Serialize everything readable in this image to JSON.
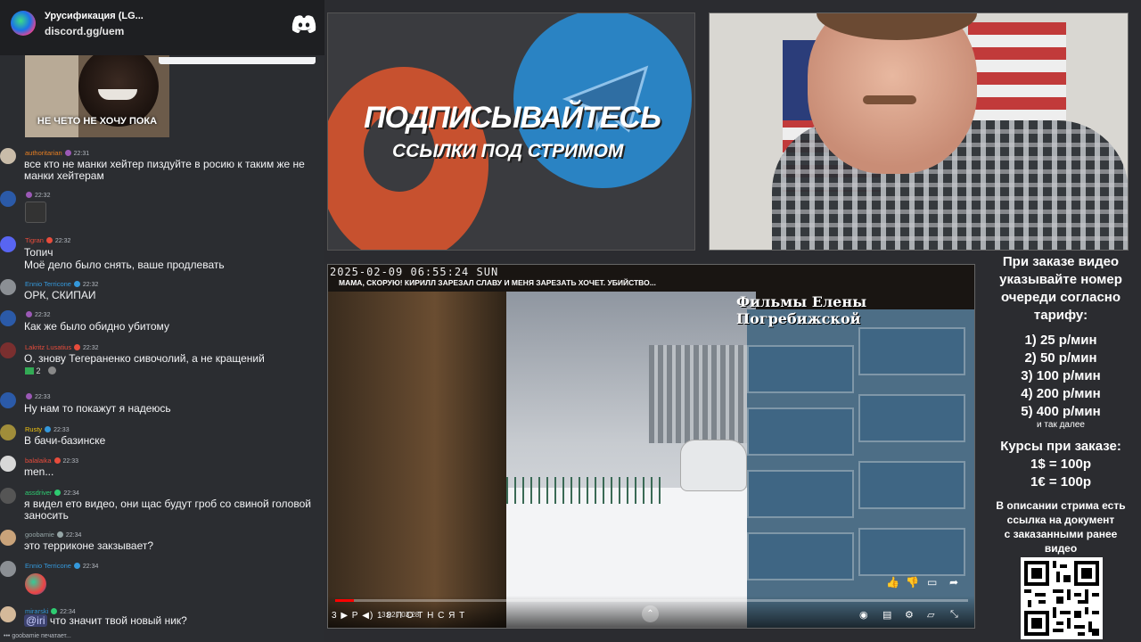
{
  "discord": {
    "server_name": "Урусификация (LG...",
    "invite": "discord.gg/uem"
  },
  "sticker_caption": "НЕ ЧЕТО НЕ ХОЧУ ПОКА",
  "messages": [
    {
      "user": "authoritarian",
      "time": "22:31",
      "text": "все кто не манки хейтер пиздуйте в росию к таким же не манки хейтерам",
      "user_color": "#e67e22"
    },
    {
      "user": "",
      "time": "22:32",
      "text": "",
      "user_color": "#9b59b6"
    },
    {
      "user": "Tigran",
      "time": "22:32",
      "text": "Топич\nМоё дело было снять, ваше продлевать",
      "user_color": "#e74c3c"
    },
    {
      "user": "Ennio Terricone",
      "time": "22:32",
      "text": "ОРК, СКИПАИ",
      "user_color": "#3498db"
    },
    {
      "user": "",
      "time": "22:32",
      "text": "Как же было обидно убитому",
      "user_color": "#9b59b6"
    },
    {
      "user": "Lakritz Lusatius",
      "time": "22:32",
      "text": "О, знову Тегераненко сивочолий, а не кращений",
      "user_color": "#e74c3c"
    },
    {
      "user": "",
      "time": "22:33",
      "text": "Ну нам то покажут я надеюсь",
      "user_color": "#9b59b6"
    },
    {
      "user": "Rusty",
      "time": "22:33",
      "text": "В бачи-базинске",
      "user_color": "#f1c40f"
    },
    {
      "user": "balalaika",
      "time": "22:33",
      "text": "men...",
      "user_color": "#e74c3c"
    },
    {
      "user": "assdriver",
      "time": "22:34",
      "text": "я видел ето видео, они щас будут гроб со свиной головой заносить",
      "user_color": "#2ecc71"
    },
    {
      "user": "goobamie",
      "time": "22:34",
      "text": "это терриконе закзывает?",
      "user_color": "#95a5a6"
    },
    {
      "user": "Ennio Terricone",
      "time": "22:34",
      "text": "",
      "user_color": "#3498db"
    },
    {
      "user": "mirarski",
      "time": "22:34",
      "text": "что значит твой новый ник?",
      "mention": "@iri",
      "user_color": "#3498db"
    }
  ],
  "reaction_count": "2",
  "typing": "goobamie печатает...",
  "promo": {
    "headline": "ПОДПИСЫВАЙТЕСЬ",
    "subline": "ССЫЛКИ ПОД СТРИМОМ"
  },
  "video": {
    "timestamp": "2025-02-09  06:55:24 SUN",
    "title": "МАМА, СКОРУЮ! КИРИЛЛ ЗАРЕЗАЛ СЛАВУ И МЕНЯ ЗАРЕЗАТЬ ХОЧЕТ. УБИЙСТВО...",
    "watermark": "Фильмы Елены Погребижской",
    "time": "3:02 / 03:28",
    "overlay_text": "3 ▶ Р ◀) 1  8  П  О  Т  Н  С  Я  Т",
    "progress": 0.03
  },
  "info": {
    "order_lines": [
      "При заказе видео",
      "указывайте номер",
      "очереди согласно",
      "тарифу:"
    ],
    "tariffs": [
      "1) 25 р/мин",
      "2) 50 р/мин",
      "3) 100 р/мин",
      "4) 200 р/мин",
      "5) 400 р/мин"
    ],
    "and_so_on": "и так далее",
    "rates_title": "Курсы при заказе:",
    "rates": [
      "1$ = 100р",
      "1€ = 100р"
    ],
    "desc_lines": [
      "В описании стрима есть",
      "ссылка на документ",
      "с заказанными ранее",
      "видео"
    ]
  }
}
